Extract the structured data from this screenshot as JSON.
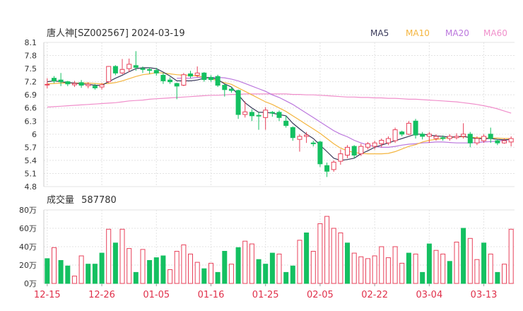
{
  "header": {
    "title": "唐人神[SZ002567] 2024-03-19",
    "legend": [
      {
        "label": "MA5",
        "color": "#3a3a5a"
      },
      {
        "label": "MA10",
        "color": "#f4b53f"
      },
      {
        "label": "MA20",
        "color": "#bb77dd"
      },
      {
        "label": "MA60",
        "color": "#f08fcb"
      }
    ]
  },
  "volume_header": {
    "label": "成交量",
    "value": "587780"
  },
  "colors": {
    "up": "#e8415a",
    "down": "#14c061",
    "grid": "#e3e3e3",
    "axis_text": "#333333",
    "date_text": "#e0304a"
  },
  "chart_data": [
    {
      "type": "candlestick",
      "title": "",
      "ylim": [
        4.8,
        8.1
      ],
      "yticks": [
        "8.1",
        "7.8",
        "7.5",
        "7.2",
        "6.9",
        "6.6",
        "6.3",
        "6",
        "5.7",
        "5.4",
        "5.1",
        "4.8"
      ],
      "ytick_values": [
        8.1,
        7.8,
        7.5,
        7.2,
        6.9,
        6.6,
        6.3,
        6.0,
        5.7,
        5.4,
        5.1,
        4.8
      ],
      "xtick_labels": [
        "12-15",
        "12-26",
        "01-05",
        "01-16",
        "01-25",
        "02-05",
        "02-22",
        "03-04",
        "03-13"
      ],
      "xtick_index": [
        0,
        8,
        16,
        24,
        32,
        40,
        48,
        56,
        64
      ],
      "candles": [
        [
          7.14,
          7.14,
          7.05,
          7.28
        ],
        [
          7.28,
          7.22,
          7.17,
          7.33
        ],
        [
          7.24,
          7.2,
          7.1,
          7.4
        ],
        [
          7.2,
          7.15,
          7.1,
          7.22
        ],
        [
          7.13,
          7.16,
          7.08,
          7.22
        ],
        [
          7.18,
          7.12,
          7.06,
          7.24
        ],
        [
          7.11,
          7.14,
          7.05,
          7.19
        ],
        [
          7.1,
          7.06,
          7.02,
          7.15
        ],
        [
          7.08,
          7.13,
          7.02,
          7.17
        ],
        [
          7.2,
          7.55,
          7.17,
          7.56
        ],
        [
          7.55,
          7.4,
          7.35,
          7.58
        ],
        [
          7.4,
          7.48,
          7.37,
          7.72
        ],
        [
          7.5,
          7.6,
          7.42,
          7.73
        ],
        [
          7.57,
          7.53,
          7.45,
          7.9
        ],
        [
          7.5,
          7.48,
          7.4,
          7.55
        ],
        [
          7.48,
          7.46,
          7.38,
          7.53
        ],
        [
          7.46,
          7.4,
          7.34,
          7.52
        ],
        [
          7.35,
          7.22,
          7.15,
          7.4
        ],
        [
          7.24,
          7.2,
          7.15,
          7.3
        ],
        [
          7.16,
          7.1,
          6.8,
          7.18
        ],
        [
          7.12,
          7.36,
          7.1,
          7.4
        ],
        [
          7.38,
          7.33,
          7.28,
          7.45
        ],
        [
          7.35,
          7.4,
          7.3,
          7.55
        ],
        [
          7.4,
          7.25,
          7.2,
          7.42
        ],
        [
          7.3,
          7.25,
          7.2,
          7.35
        ],
        [
          7.32,
          7.12,
          7.08,
          7.36
        ],
        [
          7.12,
          7.02,
          6.86,
          7.15
        ],
        [
          7.03,
          7.0,
          6.95,
          7.08
        ],
        [
          7.0,
          6.45,
          6.35,
          7.02
        ],
        [
          6.45,
          6.51,
          6.38,
          6.75
        ],
        [
          6.5,
          6.42,
          6.3,
          6.57
        ],
        [
          6.43,
          6.42,
          6.1,
          6.5
        ],
        [
          6.38,
          6.55,
          6.1,
          6.62
        ],
        [
          6.5,
          6.48,
          6.4,
          6.53
        ],
        [
          6.5,
          6.38,
          6.3,
          6.54
        ],
        [
          6.3,
          6.2,
          6.15,
          6.42
        ],
        [
          6.15,
          5.92,
          5.85,
          6.18
        ],
        [
          5.88,
          5.95,
          5.6,
          6.0
        ],
        [
          5.95,
          5.98,
          5.8,
          6.05
        ],
        [
          5.8,
          5.78,
          5.72,
          5.85
        ],
        [
          5.82,
          5.32,
          5.25,
          5.85
        ],
        [
          5.28,
          5.15,
          5.02,
          5.35
        ],
        [
          5.19,
          5.36,
          5.14,
          5.4
        ],
        [
          5.38,
          5.55,
          5.3,
          5.65
        ],
        [
          5.52,
          5.7,
          5.45,
          5.75
        ],
        [
          5.72,
          5.52,
          5.45,
          5.75
        ],
        [
          5.55,
          5.72,
          5.5,
          5.78
        ],
        [
          5.7,
          5.78,
          5.65,
          5.82
        ],
        [
          5.72,
          5.8,
          5.65,
          5.85
        ],
        [
          5.78,
          5.86,
          5.7,
          5.9
        ],
        [
          5.8,
          5.9,
          5.75,
          5.95
        ],
        [
          5.85,
          6.1,
          5.8,
          6.15
        ],
        [
          6.05,
          6.0,
          5.95,
          6.08
        ],
        [
          6.0,
          6.25,
          5.98,
          6.3
        ],
        [
          6.3,
          5.98,
          5.9,
          6.35
        ],
        [
          6.0,
          5.95,
          5.88,
          6.05
        ],
        [
          5.95,
          6.0,
          5.8,
          6.05
        ],
        [
          5.9,
          5.95,
          5.85,
          6.0
        ],
        [
          5.92,
          5.9,
          5.85,
          5.97
        ],
        [
          5.9,
          5.95,
          5.85,
          6.0
        ],
        [
          5.92,
          5.95,
          5.88,
          6.02
        ],
        [
          5.95,
          6.0,
          5.9,
          6.25
        ],
        [
          6.0,
          5.8,
          5.7,
          6.05
        ],
        [
          5.8,
          5.9,
          5.75,
          5.95
        ],
        [
          5.85,
          5.95,
          5.8,
          6.0
        ],
        [
          6.0,
          5.9,
          5.8,
          6.15
        ],
        [
          5.85,
          5.8,
          5.75,
          5.88
        ],
        [
          5.8,
          5.85,
          5.78,
          5.9
        ],
        [
          5.82,
          5.9,
          5.72,
          5.95
        ]
      ],
      "ma": {
        "MA5": [
          7.2,
          7.22,
          7.2,
          7.18,
          7.17,
          7.15,
          7.14,
          7.12,
          7.12,
          7.2,
          7.28,
          7.35,
          7.43,
          7.5,
          7.52,
          7.52,
          7.5,
          7.42,
          7.33,
          7.22,
          7.22,
          7.22,
          7.24,
          7.28,
          7.3,
          7.25,
          7.15,
          7.08,
          6.9,
          6.72,
          6.6,
          6.5,
          6.5,
          6.48,
          6.45,
          6.42,
          6.25,
          6.12,
          6.0,
          5.9,
          5.75,
          5.6,
          5.45,
          5.4,
          5.42,
          5.45,
          5.55,
          5.62,
          5.7,
          5.75,
          5.8,
          5.85,
          5.9,
          5.95,
          6.0,
          6.0,
          5.98,
          5.96,
          5.95,
          5.93,
          5.94,
          5.95,
          5.92,
          5.9,
          5.9,
          5.9,
          5.88,
          5.87,
          5.88
        ],
        "MA10": [
          7.15,
          7.16,
          7.17,
          7.17,
          7.17,
          7.17,
          7.17,
          7.16,
          7.15,
          7.16,
          7.18,
          7.22,
          7.27,
          7.32,
          7.36,
          7.38,
          7.41,
          7.4,
          7.38,
          7.36,
          7.35,
          7.35,
          7.33,
          7.31,
          7.27,
          7.22,
          7.18,
          7.14,
          7.06,
          6.98,
          6.9,
          6.82,
          6.74,
          6.68,
          6.6,
          6.52,
          6.42,
          6.32,
          6.22,
          6.12,
          6.02,
          5.9,
          5.78,
          5.68,
          5.62,
          5.58,
          5.56,
          5.55,
          5.55,
          5.55,
          5.56,
          5.6,
          5.66,
          5.72,
          5.76,
          5.82,
          5.86,
          5.88,
          5.9,
          5.92,
          5.94,
          5.94,
          5.93,
          5.92,
          5.91,
          5.91,
          5.91,
          5.9,
          5.9
        ],
        "MA20": [
          null,
          null,
          null,
          null,
          null,
          null,
          null,
          null,
          null,
          null,
          null,
          null,
          null,
          null,
          null,
          null,
          null,
          null,
          null,
          7.28,
          7.28,
          7.28,
          7.3,
          7.3,
          7.3,
          7.3,
          7.29,
          7.26,
          7.22,
          7.16,
          7.1,
          7.04,
          6.98,
          6.9,
          6.84,
          6.76,
          6.68,
          6.58,
          6.48,
          6.38,
          6.28,
          6.18,
          6.08,
          6.0,
          5.94,
          5.86,
          5.8,
          5.75,
          5.72,
          5.7,
          5.7,
          5.72,
          5.75,
          5.77,
          5.78,
          5.8,
          5.81,
          5.82,
          5.82,
          5.81,
          5.8,
          5.8,
          5.8,
          5.81,
          5.82,
          5.83,
          5.84,
          5.86,
          5.88
        ],
        "MA60": [
          6.62,
          6.63,
          6.64,
          6.65,
          6.66,
          6.67,
          6.68,
          6.69,
          6.7,
          6.71,
          6.72,
          6.74,
          6.76,
          6.77,
          6.78,
          6.8,
          6.81,
          6.82,
          6.83,
          6.84,
          6.85,
          6.86,
          6.87,
          6.88,
          6.89,
          6.89,
          6.9,
          6.91,
          6.91,
          6.92,
          6.92,
          6.92,
          6.92,
          6.92,
          6.92,
          6.92,
          6.91,
          6.91,
          6.9,
          6.9,
          6.89,
          6.88,
          6.87,
          6.86,
          6.85,
          6.85,
          6.84,
          6.84,
          6.83,
          6.83,
          6.82,
          6.82,
          6.81,
          6.8,
          6.8,
          6.79,
          6.78,
          6.77,
          6.76,
          6.75,
          6.74,
          6.72,
          6.7,
          6.68,
          6.65,
          6.62,
          6.58,
          6.53,
          6.48
        ]
      }
    },
    {
      "type": "bar",
      "title": "",
      "unit": "万",
      "ylim": [
        0,
        80
      ],
      "yticks": [
        "80万",
        "60万",
        "40万",
        "20万",
        "0万"
      ],
      "ytick_values": [
        80,
        60,
        40,
        20,
        0
      ],
      "values": [
        27,
        39,
        25,
        19,
        8,
        30,
        21,
        21,
        33,
        59,
        44,
        59,
        38,
        12,
        37,
        25,
        28,
        30,
        15,
        35,
        42,
        32,
        23,
        16,
        22,
        12,
        35,
        21,
        39,
        46,
        43,
        26,
        21,
        33,
        32,
        12,
        19,
        47,
        55,
        35,
        65,
        73,
        60,
        55,
        44,
        33,
        29,
        27,
        30,
        40,
        28,
        40,
        22,
        33,
        32,
        12,
        43,
        36,
        32,
        24,
        45,
        60,
        49,
        26,
        44,
        32,
        12,
        21,
        59
      ],
      "colors": [
        "down",
        "up",
        "down",
        "down",
        "up",
        "up",
        "down",
        "down",
        "down",
        "up",
        "down",
        "up",
        "up",
        "down",
        "up",
        "down",
        "down",
        "down",
        "up",
        "up",
        "up",
        "up",
        "up",
        "down",
        "up",
        "down",
        "down",
        "up",
        "down",
        "up",
        "up",
        "down",
        "down",
        "down",
        "up",
        "down",
        "down",
        "up",
        "down",
        "up",
        "up",
        "up",
        "up",
        "up",
        "down",
        "up",
        "up",
        "up",
        "up",
        "up",
        "up",
        "up",
        "up",
        "down",
        "up",
        "down",
        "down",
        "up",
        "up",
        "down",
        "up",
        "down",
        "up",
        "up",
        "down",
        "up",
        "down",
        "up",
        "up"
      ]
    }
  ]
}
